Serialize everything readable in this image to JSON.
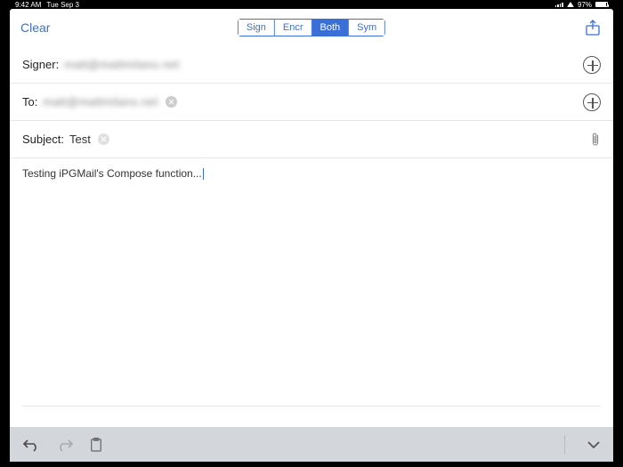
{
  "status_bar": {
    "time": "9:42 AM",
    "date": "Tue Sep 3",
    "battery_pct": "97%"
  },
  "toolbar": {
    "clear": "Clear",
    "segments": [
      "Sign",
      "Encr",
      "Both",
      "Sym"
    ],
    "active_segment": "Both"
  },
  "fields": {
    "signer_label": "Signer:",
    "signer_value": "matt@mattmilano.net",
    "to_label": "To:",
    "to_value": "matt@mattmilano.net",
    "subject_label": "Subject:",
    "subject_value": "Test"
  },
  "body": "Testing iPGMail's Compose function..."
}
